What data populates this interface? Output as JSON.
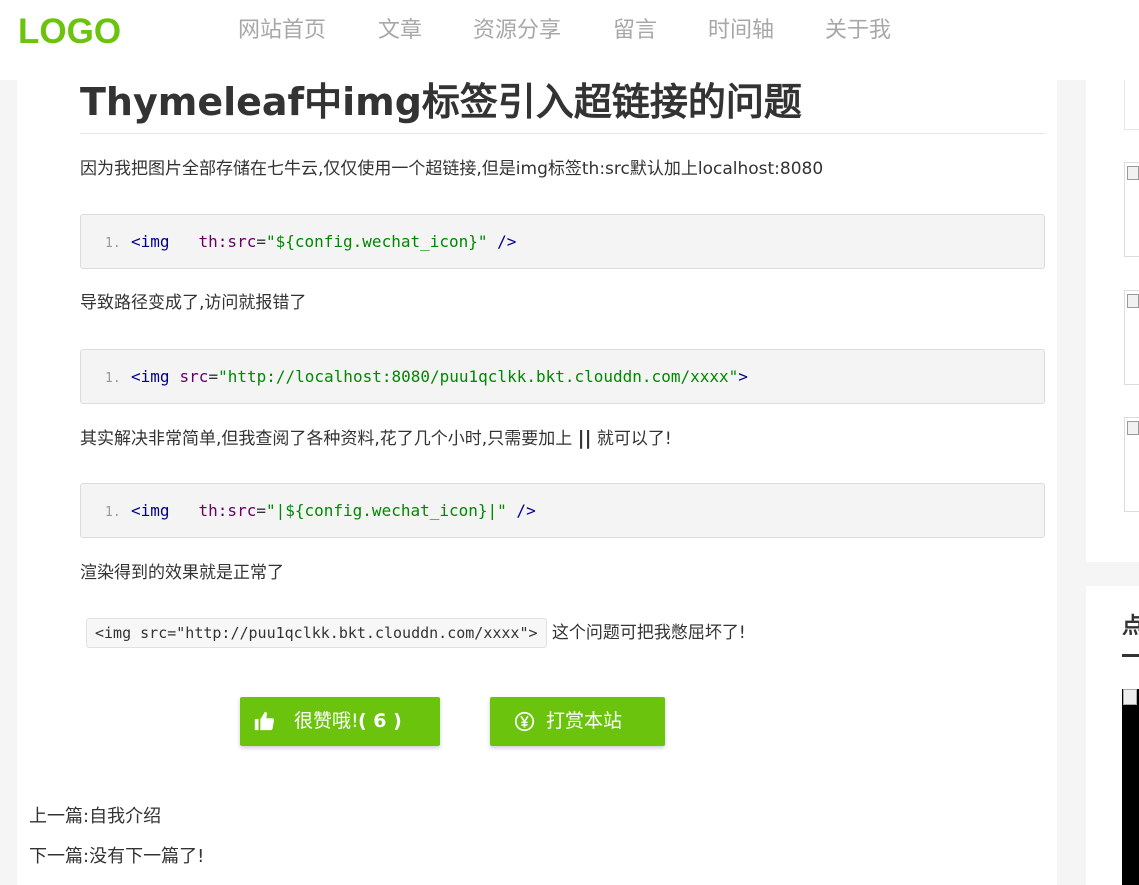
{
  "header": {
    "logo": "LOGO",
    "nav": [
      "网站首页",
      "文章",
      "资源分享",
      "留言",
      "时间轴",
      "关于我"
    ]
  },
  "article": {
    "title": "Thymeleaf中img标签引入超链接的问题",
    "p1": "因为我把图片全部存储在七牛云,仅仅使用一个超链接,但是img标签th:src默认加上localhost:8080",
    "code1": {
      "line": "1.",
      "tag": "<img",
      "attr": "th:src",
      "eq": "=",
      "str": "\"${config.wechat_icon}\"",
      "end": " />"
    },
    "p2": "导致路径变成了,访问就报错了",
    "code2": {
      "line": "1.",
      "tag": "<img",
      "attr": "src",
      "eq": "=",
      "str": "\"http://localhost:8080/puu1qclkk.bkt.clouddn.com/xxxx\"",
      "end": ">"
    },
    "p3_before": "其实解决非常简单,但我查阅了各种资料,花了几个小时,只需要加上 ",
    "p3_strong": "||",
    "p3_after": " 就可以了!",
    "code3": {
      "line": "1.",
      "tag": "<img",
      "attr": "th:src",
      "eq": "=",
      "str": "\"|${config.wechat_icon}|\"",
      "end": " />"
    },
    "p4": "渲染得到的效果就是正常了",
    "inline_code": "<img src=\"http://puu1qclkk.bkt.clouddn.com/xxxx\">",
    "p5_after": " 这个问题可把我憋屈坏了!"
  },
  "actions": {
    "like_label": "很赞哦!",
    "like_count": "( 6 )",
    "reward_label": "打赏本站",
    "accent": "#6bc30d"
  },
  "nav_links": {
    "prev_label": "上一篇:",
    "prev_title": "自我介绍",
    "next_label": "下一篇:",
    "next_title": "没有下一篇了!"
  },
  "sidebar": {
    "heading_fragment": "点"
  },
  "icons": [
    "thumbs-up-icon",
    "yen-circle-icon",
    "broken-image-icon"
  ]
}
